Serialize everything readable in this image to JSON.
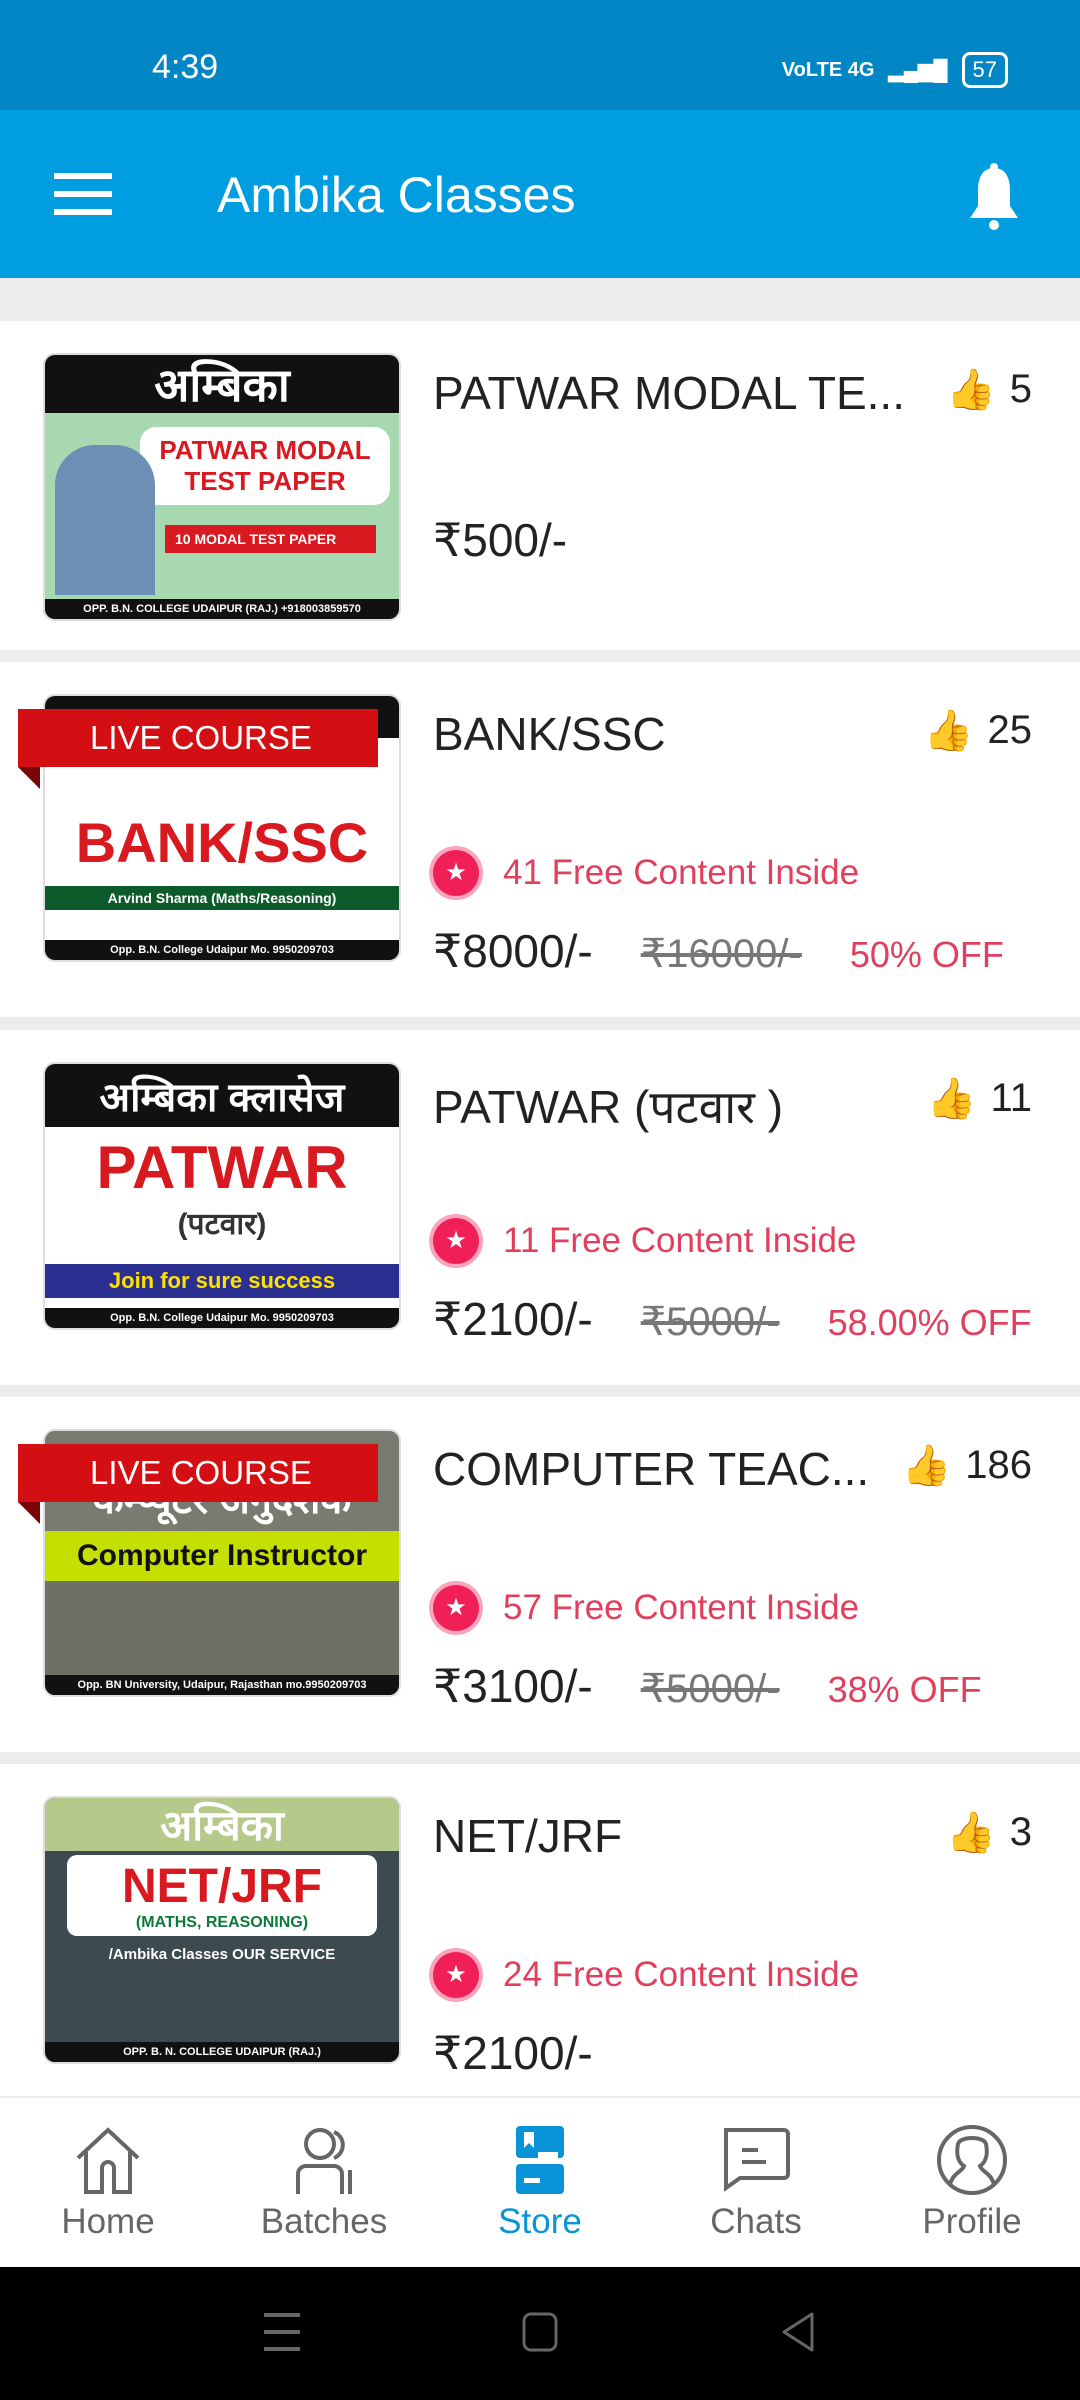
{
  "status_bar": {
    "time": "4:39",
    "network": "VoLTE 4G",
    "battery": "57"
  },
  "app_bar": {
    "title": "Ambika Classes",
    "menu_icon": "hamburger-icon",
    "notification_icon": "bell-icon"
  },
  "colors": {
    "primary": "#009de0",
    "status_bar": "#0086c5",
    "accent_red": "#e0405d",
    "like": "#f03e50"
  },
  "courses": [
    {
      "title": "PATWAR MODAL TE...",
      "likes": "5",
      "price": "₹500/-",
      "thumb": {
        "top": "अम्बिका",
        "main": "PATWAR MODAL TEST PAPER",
        "sub": "10 MODAL TEST PAPER",
        "footer": "OPP. B.N. COLLEGE UDAIPUR (RAJ.) +918003859570"
      }
    },
    {
      "title": "BANK/SSC",
      "likes": "25",
      "live_label": "LIVE COURSE",
      "free_content": "41 Free Content Inside",
      "price": "₹8000/-",
      "old_price": "₹16000/-",
      "discount": "50% OFF",
      "thumb": {
        "main": "BANK/SSC",
        "sub": "Arvind Sharma (Maths/Reasoning)",
        "footer": "Opp. B.N. College Udaipur Mo. 9950209703"
      }
    },
    {
      "title": "PATWAR (पटवार )",
      "likes": "11",
      "free_content": "11 Free Content Inside",
      "price": "₹2100/-",
      "old_price": "₹5000/-",
      "discount": "58.00% OFF",
      "thumb": {
        "top": "अम्बिका क्लासेज",
        "main": "PATWAR",
        "sub": "(पटवार)",
        "tagline": "Join for sure success",
        "footer": "Opp. B.N. College Udaipur Mo. 9950209703"
      }
    },
    {
      "title": "COMPUTER TEAC...",
      "likes": "186",
      "live_label": "LIVE COURSE",
      "free_content": "57 Free Content Inside",
      "price": "₹3100/-",
      "old_price": "₹5000/-",
      "discount": "38% OFF",
      "thumb": {
        "top": "कम्प्यूटर अनुदेशक",
        "main": "Computer Instructor",
        "footer": "Opp. BN University, Udaipur, Rajasthan mo.9950209703"
      }
    },
    {
      "title": "NET/JRF",
      "likes": "3",
      "free_content": "24 Free Content Inside",
      "price": "₹2100/-",
      "thumb": {
        "top": "अम्बिका",
        "main": "NET/JRF",
        "sub": "(MATHS, REASONING)",
        "tagline": "/Ambika Classes OUR SERVICE",
        "footer": "OPP. B. N. COLLEGE UDAIPUR (RAJ.)"
      }
    }
  ],
  "bottom_nav": [
    {
      "label": "Home",
      "icon": "home-icon"
    },
    {
      "label": "Batches",
      "icon": "users-icon"
    },
    {
      "label": "Store",
      "icon": "store-icon",
      "active": true
    },
    {
      "label": "Chats",
      "icon": "chat-icon"
    },
    {
      "label": "Profile",
      "icon": "profile-icon"
    }
  ]
}
